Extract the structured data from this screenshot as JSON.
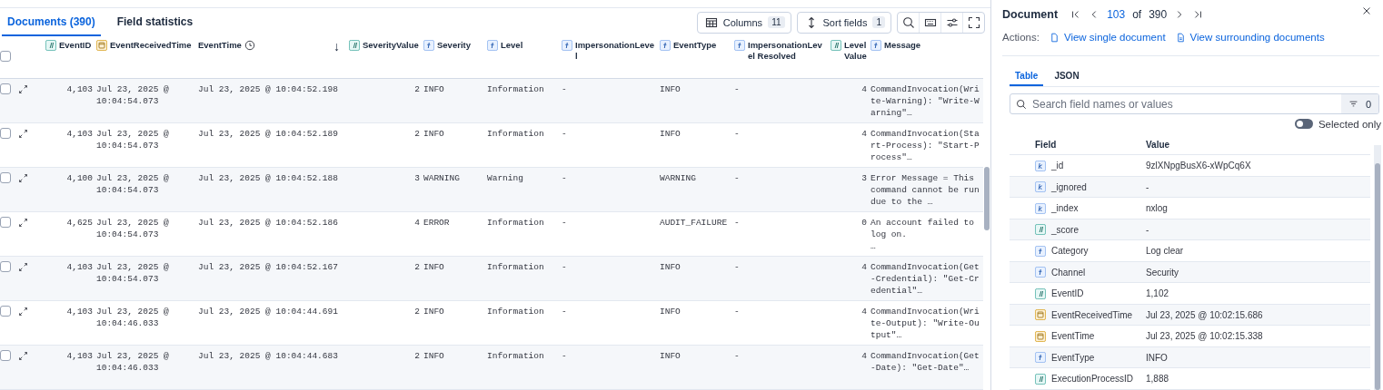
{
  "tabs": [
    {
      "label": "Documents (390)",
      "selected": true
    },
    {
      "label": "Field statistics",
      "selected": false
    }
  ],
  "toolbar": {
    "columns": {
      "label": "Columns",
      "count": "11"
    },
    "sort": {
      "label": "Sort fields",
      "count": "1"
    }
  },
  "grid": {
    "header_checked": false,
    "sort_indicator": "↓",
    "columns": [
      {
        "label": "EventID",
        "kind": "number"
      },
      {
        "label": "EventReceivedTime",
        "kind": "date"
      },
      {
        "label": "EventTime",
        "kind": "time"
      },
      {
        "label": "SeverityValue",
        "kind": "number"
      },
      {
        "label": "Severity",
        "kind": "string"
      },
      {
        "label": "Level",
        "kind": "string"
      },
      {
        "label": "ImpersonationLevel",
        "kind": "string"
      },
      {
        "label": "EventType",
        "kind": "string"
      },
      {
        "label": "ImpersonationLevel Resolved",
        "kind": "string"
      },
      {
        "label": "LevelValue",
        "kind": "number"
      },
      {
        "label": "Message",
        "kind": "string"
      }
    ],
    "rows": [
      {
        "checked": false,
        "cells": [
          "4,103",
          "Jul 23, 2025 @ 10:04:54.073",
          "Jul 23, 2025 @ 10:04:52.198",
          "2",
          "INFO",
          "Information",
          "-",
          "INFO",
          "-",
          "4",
          "CommandInvocation(Write-Warning): \"Write-Warning\"…"
        ]
      },
      {
        "checked": false,
        "cells": [
          "4,103",
          "Jul 23, 2025 @ 10:04:54.073",
          "Jul 23, 2025 @ 10:04:52.189",
          "2",
          "INFO",
          "Information",
          "-",
          "INFO",
          "-",
          "4",
          "CommandInvocation(Start-Process): \"Start-Process\"…"
        ]
      },
      {
        "checked": false,
        "cells": [
          "4,100",
          "Jul 23, 2025 @ 10:04:54.073",
          "Jul 23, 2025 @ 10:04:52.188",
          "3",
          "WARNING",
          "Warning",
          "-",
          "WARNING",
          "-",
          "3",
          "Error Message = This command cannot be run due to the …"
        ]
      },
      {
        "checked": false,
        "cells": [
          "4,625",
          "Jul 23, 2025 @ 10:04:54.073",
          "Jul 23, 2025 @ 10:04:52.186",
          "4",
          "ERROR",
          "Information",
          "-",
          "AUDIT_FAILURE",
          "-",
          "0",
          "An account failed to log on.\n…"
        ]
      },
      {
        "checked": false,
        "cells": [
          "4,103",
          "Jul 23, 2025 @ 10:04:54.073",
          "Jul 23, 2025 @ 10:04:52.167",
          "2",
          "INFO",
          "Information",
          "-",
          "INFO",
          "-",
          "4",
          "CommandInvocation(Get-Credential): \"Get-Credential\"…"
        ]
      },
      {
        "checked": false,
        "cells": [
          "4,103",
          "Jul 23, 2025 @ 10:04:46.033",
          "Jul 23, 2025 @ 10:04:44.691",
          "2",
          "INFO",
          "Information",
          "-",
          "INFO",
          "-",
          "4",
          "CommandInvocation(Write-Output): \"Write-Output\"…"
        ]
      },
      {
        "checked": false,
        "cells": [
          "4,103",
          "Jul 23, 2025 @ 10:04:46.033",
          "Jul 23, 2025 @ 10:04:44.683",
          "2",
          "INFO",
          "Information",
          "-",
          "INFO",
          "-",
          "4",
          "CommandInvocation(Get-Date): \"Get-Date\"…"
        ]
      }
    ]
  },
  "document": {
    "title": "Document",
    "current": "103",
    "of": "of",
    "total": "390",
    "actions_label": "Actions:",
    "actions": [
      "View single document",
      "View surrounding documents"
    ],
    "tabs": [
      {
        "label": "Table",
        "selected": true
      },
      {
        "label": "JSON",
        "selected": false
      }
    ],
    "search": {
      "placeholder": "Search field names or values",
      "filter_count": "0"
    },
    "selected_only": {
      "label": "Selected only",
      "on": false
    },
    "columns": [
      "Field",
      "Value"
    ],
    "fields": [
      {
        "kind": "keyword",
        "field": "_id",
        "value": "9zlXNpgBusX6-xWpCq6X"
      },
      {
        "kind": "keyword",
        "field": "_ignored",
        "value": "-"
      },
      {
        "kind": "keyword",
        "field": "_index",
        "value": "nxlog"
      },
      {
        "kind": "number",
        "field": "_score",
        "value": "-"
      },
      {
        "kind": "string",
        "field": "Category",
        "value": "Log clear"
      },
      {
        "kind": "string",
        "field": "Channel",
        "value": "Security"
      },
      {
        "kind": "number",
        "field": "EventID",
        "value": "1,102"
      },
      {
        "kind": "date",
        "field": "EventReceivedTime",
        "value": "Jul 23, 2025 @ 10:02:15.686"
      },
      {
        "kind": "date",
        "field": "EventTime",
        "value": "Jul 23, 2025 @ 10:02:15.338"
      },
      {
        "kind": "string",
        "field": "EventType",
        "value": "INFO"
      },
      {
        "kind": "number",
        "field": "ExecutionProcessID",
        "value": "1,888"
      }
    ]
  }
}
